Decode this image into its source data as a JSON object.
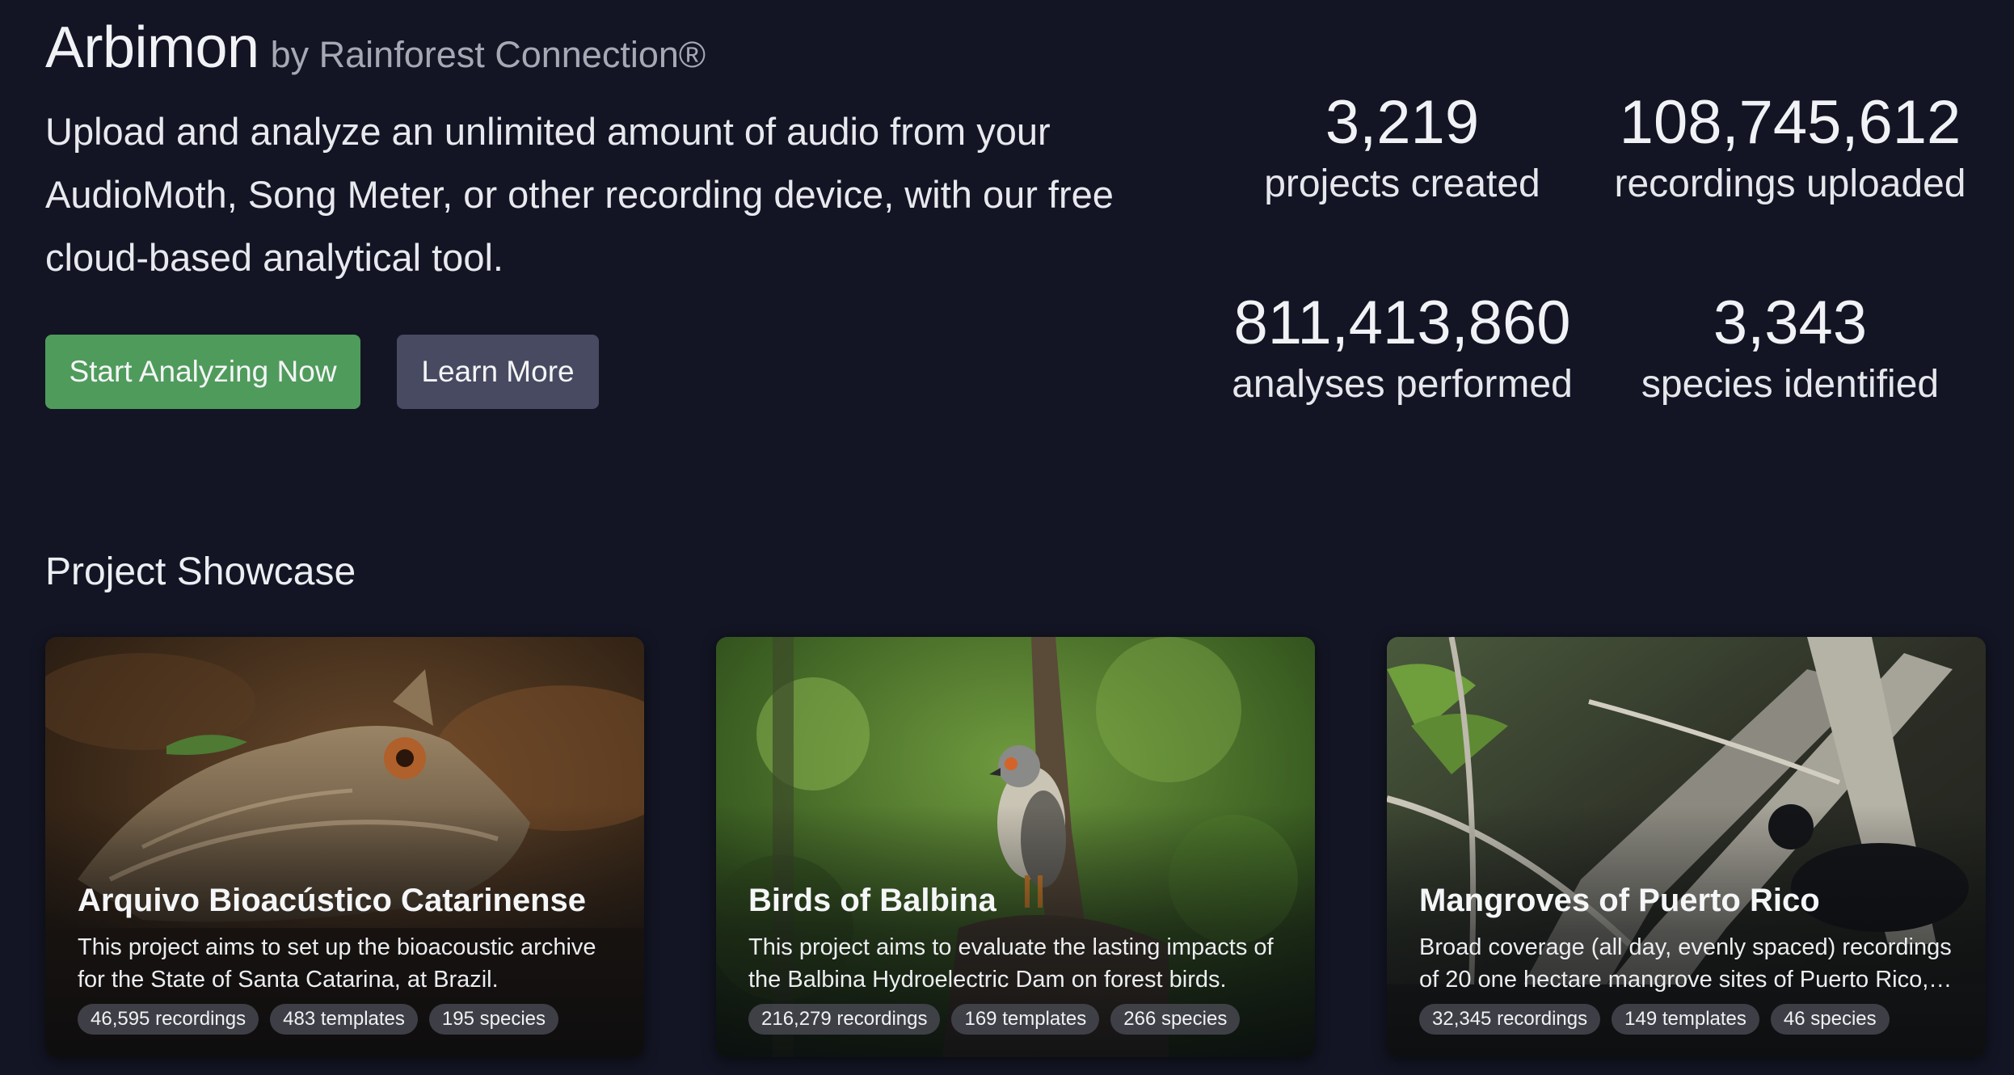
{
  "brand": {
    "name": "Arbimon",
    "by": "by Rainforest Connection®"
  },
  "hero": {
    "tagline": "Upload and analyze an unlimited amount of audio from your AudioMoth, Song Meter, or other recording device, with our free cloud-based analytical tool.",
    "primary_button": "Start Analyzing Now",
    "secondary_button": "Learn More"
  },
  "stats": [
    {
      "value": "3,219",
      "label": "projects created"
    },
    {
      "value": "108,745,612",
      "label": "recordings uploaded"
    },
    {
      "value": "811,413,860",
      "label": "analyses performed"
    },
    {
      "value": "3,343",
      "label": "species identified"
    }
  ],
  "showcase": {
    "title": "Project Showcase",
    "projects": [
      {
        "title": "Arquivo Bioacústico Catarinense",
        "description": "This project aims to set up the bioacoustic archive for the State of Santa Catarina, at Brazil.",
        "recordings": "46,595 recordings",
        "templates": "483 templates",
        "species": "195 species"
      },
      {
        "title": "Birds of Balbina",
        "description": "This project aims to evaluate the lasting impacts of the Balbina Hydroelectric Dam on forest birds.",
        "recordings": "216,279 recordings",
        "templates": "169 templates",
        "species": "266 species"
      },
      {
        "title": "Mangroves of Puerto Rico",
        "description": "Broad coverage (all day, evenly spaced) recordings of 20 one hectare mangrove sites of Puerto Rico, with a...",
        "recordings": "32,345 recordings",
        "templates": "149 templates",
        "species": "46 species"
      }
    ]
  },
  "colors": {
    "background": "#131524",
    "primary_button": "#4f9b5b",
    "secondary_button": "#474a60"
  }
}
